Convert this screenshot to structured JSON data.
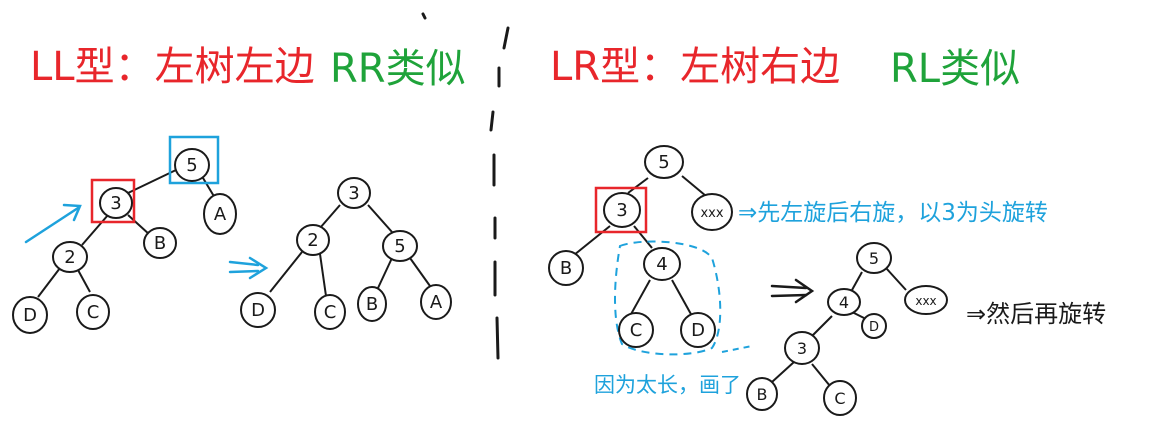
{
  "headings": {
    "ll": "LL型：左树左边",
    "rr": "RR类似",
    "lr": "LR型：左树右边",
    "rl": "RL类似"
  },
  "notes": {
    "rotate_left_then_right": "⇒先左旋后右旋，以3为头旋转",
    "then_rotate": "⇒然后再旋转",
    "because_too_long": "因为太长，画了"
  },
  "nodes": {
    "ll_before": {
      "n5": "5",
      "n3": "3",
      "nB": "B",
      "nA": "A",
      "n2": "2",
      "nD": "D",
      "nC": "C"
    },
    "ll_after": {
      "n3": "3",
      "n2": "2",
      "n5": "5",
      "nD": "D",
      "nC": "C",
      "nB": "B",
      "nA": "A"
    },
    "lr_before": {
      "n5": "5",
      "n3": "3",
      "nX": "xxx",
      "nB": "B",
      "n4": "4",
      "nC": "C",
      "nD": "D"
    },
    "lr_mid": {
      "n5": "5",
      "n4": "4",
      "nX": "xxx",
      "nD": "D",
      "n3": "3",
      "nB": "B",
      "nC": "C"
    }
  },
  "colors": {
    "red": "#e8262b",
    "green": "#1fa33a",
    "blue": "#1ea2dc",
    "ink": "#1a1a1a"
  }
}
